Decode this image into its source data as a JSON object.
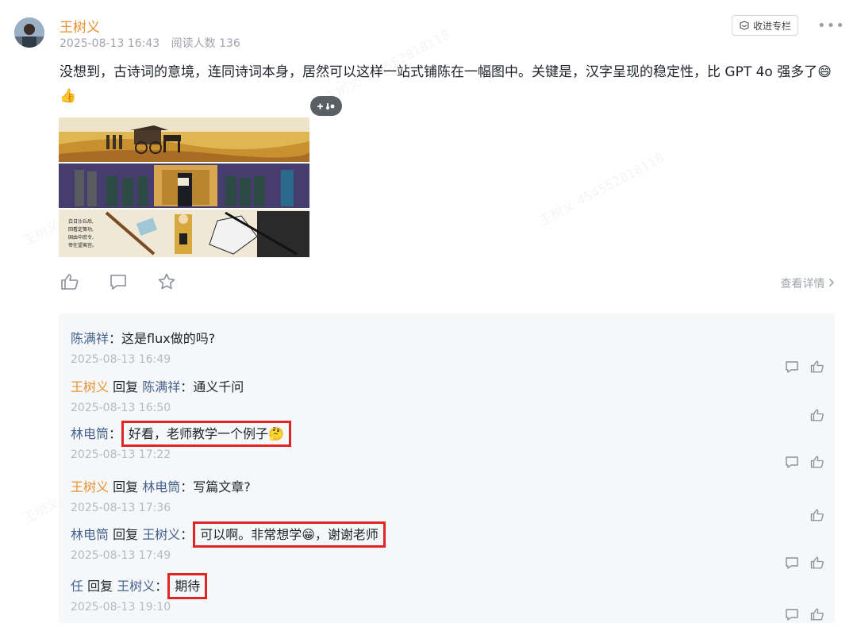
{
  "post": {
    "author": "王树义",
    "date": "2025-08-13 16:43",
    "reads": "阅读人数 136",
    "collect_label": "收进专栏",
    "body": "没想到，古诗词的意境，连同诗词本身，居然可以这样一站式铺陈在一幅图中。关键是，汉字呈现的稳定性，比 GPT 4o 强多了😄👍",
    "image_poem": [
      "白日沙丘后,",
      "回看定策功,",
      "国由中庶令,",
      "帝在望夷宫。"
    ],
    "detail_link": "查看详情"
  },
  "watermark_text": "王树义 454552818118",
  "comments": [
    {
      "name": "陈满祥",
      "reply_to": "",
      "text": "这是flux做的吗?",
      "time": "2025-08-13 16:49"
    },
    {
      "name": "王树义",
      "reply_to": "陈满祥",
      "text": "通义千问",
      "time": "2025-08-13 16:50"
    },
    {
      "name": "林电筒",
      "reply_to": "",
      "text": "好看，老师教学一个例子🤔",
      "time": "2025-08-13 17:22"
    },
    {
      "name": "王树义",
      "reply_to": "林电筒",
      "text": "写篇文章?",
      "time": "2025-08-13 17:36"
    },
    {
      "name": "林电筒",
      "reply_to": "王树义",
      "text": "可以啊。非常想学😁，谢谢老师",
      "time": "2025-08-13 17:49"
    },
    {
      "name": "任",
      "reply_to": "王树义",
      "text": "期待",
      "time": "2025-08-13 19:10"
    }
  ],
  "labels": {
    "reply": "回复",
    "colon": "："
  }
}
